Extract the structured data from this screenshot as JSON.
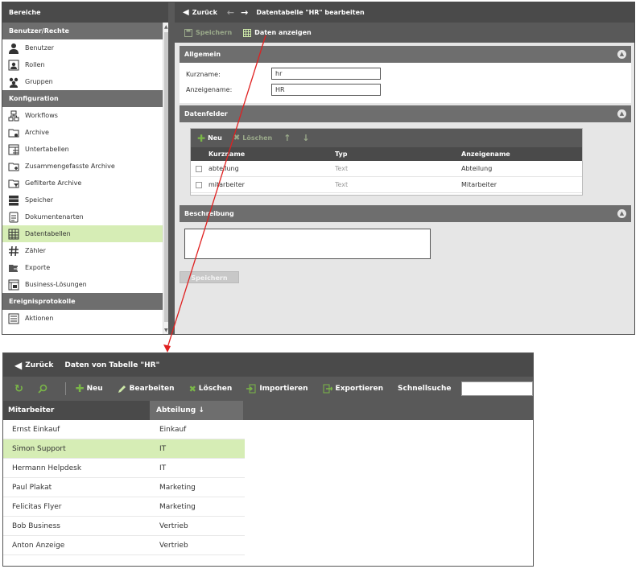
{
  "colors": {
    "accent_green": "#7ab648",
    "selected_row": "#d6edb5",
    "connector_red": "#e02020"
  },
  "sidebar": {
    "header": "Bereiche",
    "sections": [
      {
        "title": "Benutzer/Rechte",
        "items": [
          {
            "label": "Benutzer",
            "icon": "user-icon"
          },
          {
            "label": "Rollen",
            "icon": "roles-icon"
          },
          {
            "label": "Gruppen",
            "icon": "group-icon"
          }
        ]
      },
      {
        "title": "Konfiguration",
        "items": [
          {
            "label": "Workflows",
            "icon": "workflow-icon"
          },
          {
            "label": "Archive",
            "icon": "archive-icon"
          },
          {
            "label": "Untertabellen",
            "icon": "subtable-icon"
          },
          {
            "label": "Zusammengefasste Archive",
            "icon": "merged-archive-icon"
          },
          {
            "label": "Gefilterte Archive",
            "icon": "filtered-archive-icon"
          },
          {
            "label": "Speicher",
            "icon": "storage-icon"
          },
          {
            "label": "Dokumentenarten",
            "icon": "document-type-icon"
          },
          {
            "label": "Datentabellen",
            "icon": "datatable-icon",
            "active": true
          },
          {
            "label": "Zähler",
            "icon": "hash-icon"
          },
          {
            "label": "Exporte",
            "icon": "export-icon"
          },
          {
            "label": "Business-Lösungen",
            "icon": "business-solution-icon"
          }
        ]
      },
      {
        "title": "Ereignisprotokolle",
        "items": [
          {
            "label": "Aktionen",
            "icon": "actions-icon"
          }
        ]
      }
    ]
  },
  "editor": {
    "back_label": "Zurück",
    "title": "Datentabelle \"HR\" bearbeiten",
    "toolbar": {
      "save_label": "Speichern",
      "show_data_label": "Daten anzeigen"
    },
    "general": {
      "title": "Allgemein",
      "shortname_label": "Kurzname:",
      "shortname_value": "hr",
      "displayname_label": "Anzeigename:",
      "displayname_value": "HR"
    },
    "fields": {
      "title": "Datenfelder",
      "new_label": "Neu",
      "delete_label": "Löschen",
      "columns": [
        "Kurzname",
        "Typ",
        "Anzeigename"
      ],
      "rows": [
        {
          "shortname": "abteilung",
          "type": "Text",
          "display": "Abteilung"
        },
        {
          "shortname": "mitarbeiter",
          "type": "Text",
          "display": "Mitarbeiter"
        }
      ]
    },
    "description": {
      "title": "Beschreibung",
      "value": ""
    },
    "save_button": "Speichern"
  },
  "data_view": {
    "back_label": "Zurück",
    "title": "Daten von Tabelle \"HR\"",
    "toolbar": {
      "new_label": "Neu",
      "edit_label": "Bearbeiten",
      "delete_label": "Löschen",
      "import_label": "Importieren",
      "export_label": "Exportieren",
      "quicksearch_label": "Schnellsuche",
      "quicksearch_value": ""
    },
    "columns": [
      "Mitarbeiter",
      "Abteilung ↓"
    ],
    "rows": [
      {
        "mitarbeiter": "Ernst Einkauf",
        "abteilung": "Einkauf"
      },
      {
        "mitarbeiter": "Simon Support",
        "abteilung": "IT",
        "selected": true
      },
      {
        "mitarbeiter": "Hermann Helpdesk",
        "abteilung": "IT"
      },
      {
        "mitarbeiter": "Paul Plakat",
        "abteilung": "Marketing"
      },
      {
        "mitarbeiter": "Felicitas Flyer",
        "abteilung": "Marketing"
      },
      {
        "mitarbeiter": "Bob Business",
        "abteilung": "Vertrieb"
      },
      {
        "mitarbeiter": "Anton Anzeige",
        "abteilung": "Vertrieb"
      }
    ]
  }
}
